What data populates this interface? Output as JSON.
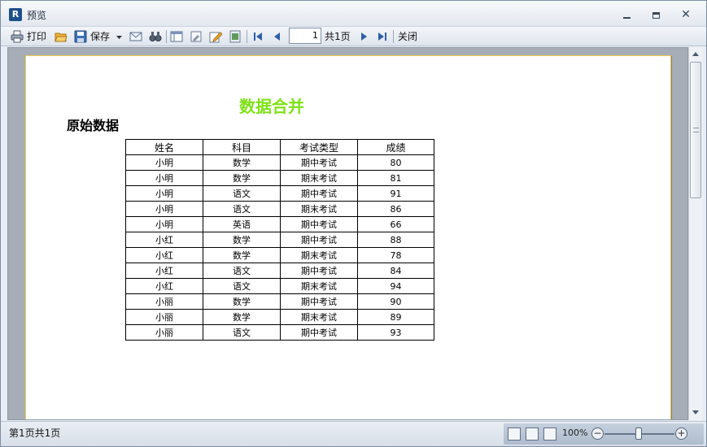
{
  "window": {
    "title": "预览",
    "app_icon_letter": "R"
  },
  "toolbar": {
    "print_label": "打印",
    "save_label": "保存",
    "page_value": "1",
    "page_total_label": "共1页",
    "close_label": "关闭"
  },
  "report": {
    "title": "数据合并",
    "section_title": "原始数据",
    "title_color": "#7ee215",
    "columns": [
      "姓名",
      "科目",
      "考试类型",
      "成绩"
    ],
    "rows": [
      [
        "小明",
        "数学",
        "期中考试",
        "80"
      ],
      [
        "小明",
        "数学",
        "期末考试",
        "81"
      ],
      [
        "小明",
        "语文",
        "期中考试",
        "91"
      ],
      [
        "小明",
        "语文",
        "期末考试",
        "86"
      ],
      [
        "小明",
        "英语",
        "期中考试",
        "66"
      ],
      [
        "小红",
        "数学",
        "期中考试",
        "88"
      ],
      [
        "小红",
        "数学",
        "期末考试",
        "78"
      ],
      [
        "小红",
        "语文",
        "期中考试",
        "84"
      ],
      [
        "小红",
        "语文",
        "期末考试",
        "94"
      ],
      [
        "小丽",
        "数学",
        "期中考试",
        "90"
      ],
      [
        "小丽",
        "数学",
        "期末考试",
        "89"
      ],
      [
        "小丽",
        "语文",
        "期中考试",
        "93"
      ]
    ]
  },
  "status": {
    "page_info": "第1页共1页",
    "zoom": "100%"
  }
}
